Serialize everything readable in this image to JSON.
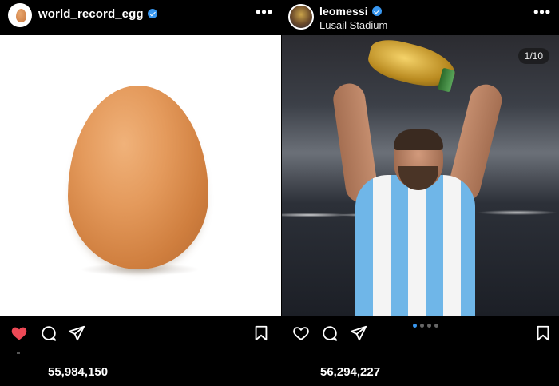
{
  "posts": [
    {
      "username": "world_record_egg",
      "location": "",
      "media_counter": "",
      "likes": "55,984,150",
      "liked": true,
      "colors": {
        "like": "#ed4956",
        "verified": "#3897f0"
      }
    },
    {
      "username": "leomessi",
      "location": "Lusail Stadium",
      "media_counter": "1/10",
      "likes": "56,294,227",
      "liked": false,
      "carousel": {
        "total_dots": 4,
        "active_index": 0
      }
    }
  ],
  "icons": {
    "more": "•••",
    "like": "heart-icon",
    "comment": "comment-icon",
    "share": "send-icon",
    "save": "bookmark-icon",
    "verified": "verified-badge-icon"
  }
}
